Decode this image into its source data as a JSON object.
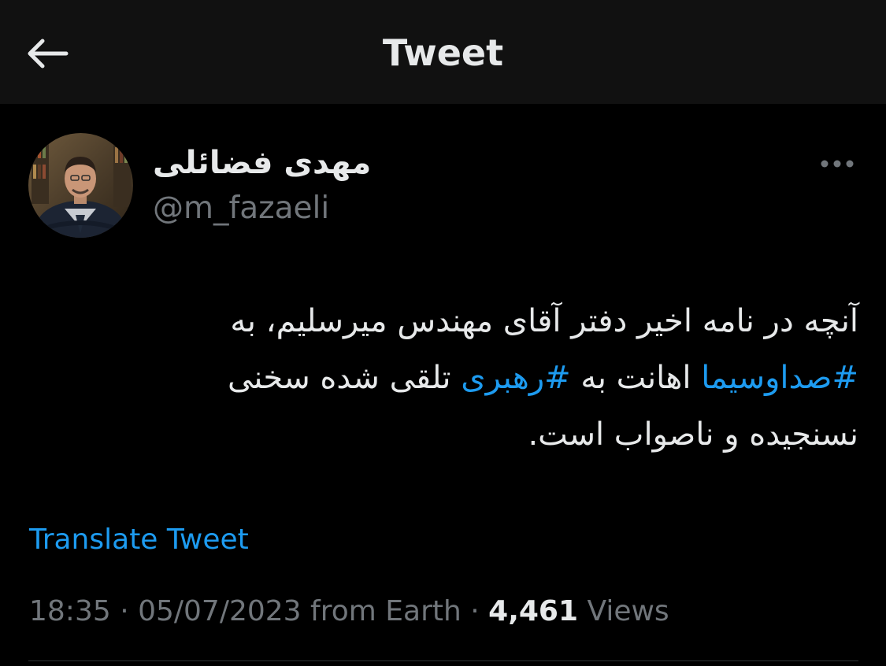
{
  "header": {
    "back_icon": "arrow-left-icon",
    "title": "Tweet"
  },
  "author": {
    "display_name": "مهدی فضائلی",
    "handle": "@m_fazaeli",
    "more_icon": "more-horizontal-icon"
  },
  "tweet": {
    "text_part1": "آنچه در نامه اخیر دفتر آقای مهندس میرسلیم، به ",
    "hashtag1": "#صداوسیما",
    "text_part2": " اهانت به ",
    "hashtag2": "#رهبری",
    "text_part3": " تلقی شده سخنی نسنجیده و ناصواب است."
  },
  "translate": {
    "label": "Translate Tweet"
  },
  "meta": {
    "time": "18:35",
    "separator": " · ",
    "date": "05/07/2023",
    "source": "from Earth",
    "views_count": "4,461",
    "views_label": "Views"
  },
  "colors": {
    "background": "#000000",
    "header_background": "#111111",
    "primary_text": "#e7e9ea",
    "secondary_text": "#71767b",
    "accent": "#1d9bf0"
  }
}
